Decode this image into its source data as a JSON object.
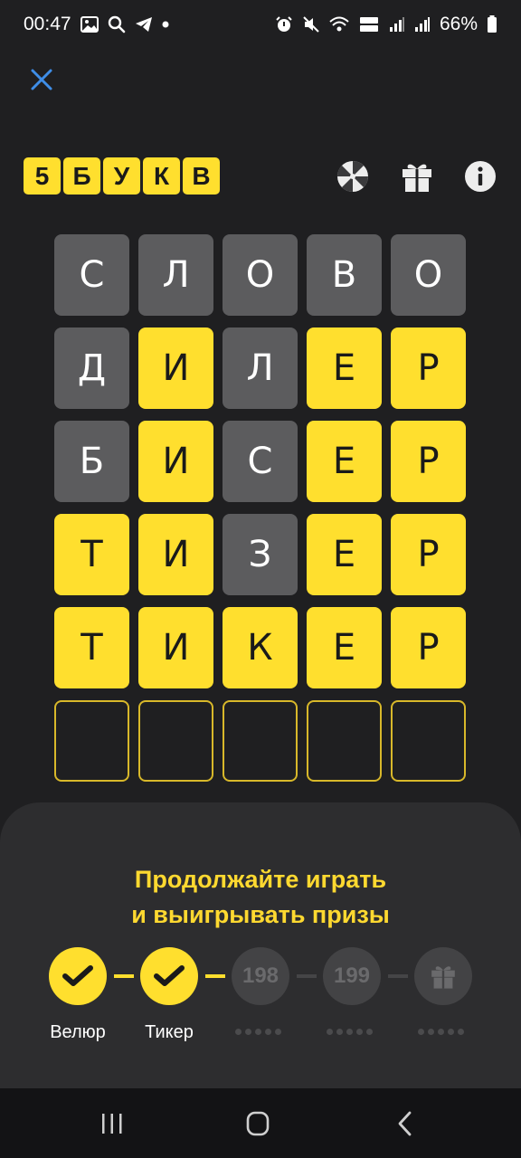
{
  "status_bar": {
    "time": "00:47",
    "battery": "66%"
  },
  "logo": [
    "5",
    "Б",
    "У",
    "К",
    "В"
  ],
  "board": [
    [
      {
        "l": "С",
        "s": "gray"
      },
      {
        "l": "Л",
        "s": "gray"
      },
      {
        "l": "О",
        "s": "gray"
      },
      {
        "l": "В",
        "s": "gray"
      },
      {
        "l": "О",
        "s": "gray"
      }
    ],
    [
      {
        "l": "Д",
        "s": "gray"
      },
      {
        "l": "И",
        "s": "yellow"
      },
      {
        "l": "Л",
        "s": "gray"
      },
      {
        "l": "Е",
        "s": "yellow"
      },
      {
        "l": "Р",
        "s": "yellow"
      }
    ],
    [
      {
        "l": "Б",
        "s": "gray"
      },
      {
        "l": "И",
        "s": "yellow"
      },
      {
        "l": "С",
        "s": "gray"
      },
      {
        "l": "Е",
        "s": "yellow"
      },
      {
        "l": "Р",
        "s": "yellow"
      }
    ],
    [
      {
        "l": "Т",
        "s": "yellow"
      },
      {
        "l": "И",
        "s": "yellow"
      },
      {
        "l": "З",
        "s": "gray"
      },
      {
        "l": "Е",
        "s": "yellow"
      },
      {
        "l": "Р",
        "s": "yellow"
      }
    ],
    [
      {
        "l": "Т",
        "s": "yellow"
      },
      {
        "l": "И",
        "s": "yellow"
      },
      {
        "l": "К",
        "s": "yellow"
      },
      {
        "l": "Е",
        "s": "yellow"
      },
      {
        "l": "Р",
        "s": "yellow"
      }
    ],
    [
      {
        "l": "",
        "s": "empty"
      },
      {
        "l": "",
        "s": "empty"
      },
      {
        "l": "",
        "s": "empty"
      },
      {
        "l": "",
        "s": "empty"
      },
      {
        "l": "",
        "s": "empty"
      }
    ]
  ],
  "sheet": {
    "title_line1": "Продолжайте играть",
    "title_line2": "и выигрывать призы",
    "steps": [
      {
        "state": "done",
        "label": "Велюр"
      },
      {
        "state": "done",
        "label": "Тикер"
      },
      {
        "state": "pending",
        "number": "198"
      },
      {
        "state": "pending",
        "number": "199"
      },
      {
        "state": "gift"
      }
    ]
  },
  "colors": {
    "accent": "#ffdf2e",
    "tile_gray": "#5c5c5e",
    "background": "#1f1f21"
  }
}
